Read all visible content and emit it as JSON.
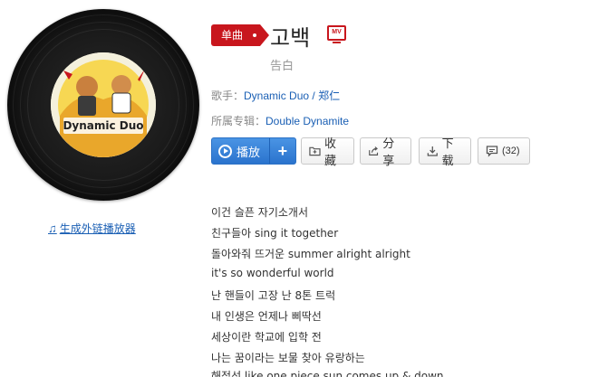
{
  "album": {
    "cover_icon": "album-cover-dynamic-duo",
    "cover_text": "Dynamic Duo"
  },
  "external_player": {
    "icon": "music-note-icon",
    "label": "生成外链播放器"
  },
  "song": {
    "badge": "单曲",
    "title": "고백",
    "mv_label": "MV",
    "subtitle": "告白"
  },
  "singer": {
    "label": "歌手：",
    "names": [
      "Dynamic Duo",
      "郑仁"
    ],
    "separator": " / "
  },
  "album_info": {
    "label": "所属专辑：",
    "name": "Double Dynamite"
  },
  "actions": {
    "play": "播放",
    "add": "+",
    "favorite": "收藏",
    "share": "分享",
    "download": "下载",
    "comment_count": "(32)"
  },
  "lyrics": [
    "이건 슬픈 자기소개서",
    "친구들아 sing it together",
    "돌아와줘 뜨거운 summer alright alright",
    "it's so wonderful world",
    "난 핸들이 고장 난 8톤 트럭",
    "내 인생은 언제나 삐딱선",
    "세상이란 학교에 입학 전",
    "나는 꿈이라는 보물 찾아 유랑하는",
    "해적선 like one piece sun comes up & down"
  ],
  "colors": {
    "accent_red": "#c8161d",
    "link_blue": "#1a5fb4",
    "play_blue": "#2a73cd"
  }
}
